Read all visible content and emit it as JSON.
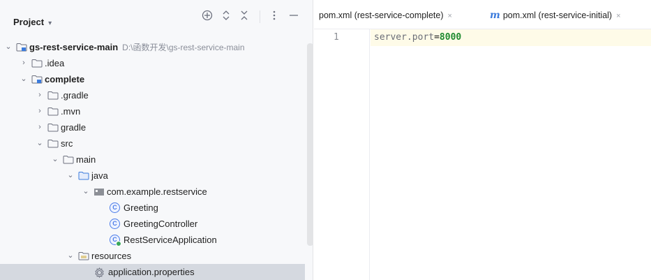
{
  "project_panel": {
    "title": "Project",
    "title_caret": "▾",
    "header_icons": [
      "target-icon",
      "expand-collapse-icon",
      "close-panel-icon",
      "options-icon",
      "minimize-icon"
    ]
  },
  "tree": {
    "root": {
      "name": "gs-rest-service-main",
      "path": "D:\\函数开发\\gs-rest-service-main"
    },
    "idea": ".idea",
    "complete": "complete",
    "gradle_hidden": ".gradle",
    "mvn": ".mvn",
    "gradle": "gradle",
    "src": "src",
    "main": "main",
    "java": "java",
    "package": "com.example.restservice",
    "class_greeting": "Greeting",
    "class_controller": "GreetingController",
    "class_app": "RestServiceApplication",
    "resources": "resources",
    "app_properties": "application.properties"
  },
  "editor": {
    "tabs": [
      {
        "label": "pom.xml (rest-service-complete)",
        "close": "×"
      },
      {
        "label": "pom.xml (rest-service-initial)",
        "close": "×",
        "icon_letter": "m"
      }
    ],
    "line_number": "1",
    "code_key": "server.port",
    "code_eq": "=",
    "code_value": "8000"
  }
}
